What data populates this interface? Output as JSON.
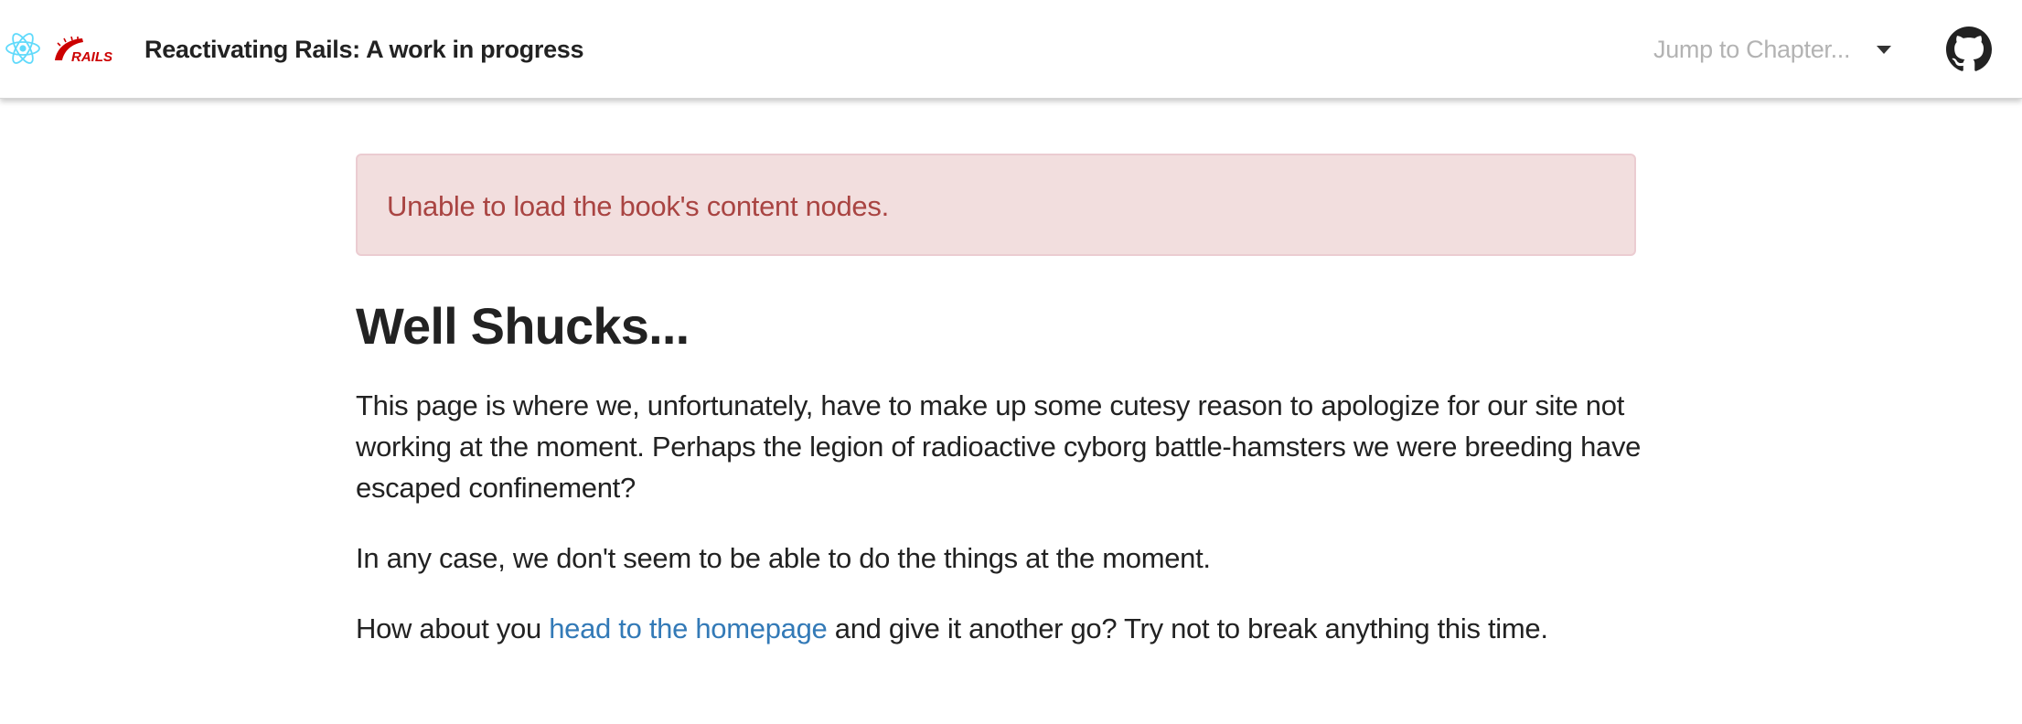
{
  "navbar": {
    "brand_title": "Reactivating Rails: A work in progress",
    "rails_logo_text": "RAILS",
    "chapter_select": {
      "placeholder": "Jump to Chapter..."
    },
    "icons": {
      "react_logo": "react-logo-icon",
      "rails_logo": "rails-logo-icon",
      "github": "github-icon",
      "dropdown": "caret-down-icon"
    }
  },
  "alert": {
    "message": "Unable to load the book's content nodes.",
    "background_color": "#f2dede",
    "border_color": "#ebccd1",
    "text_color": "#a94442"
  },
  "main": {
    "title": "Well Shucks...",
    "paragraph_1": "This page is where we, unfortunately, have to make up some cutesy reason to apologize for our site not working at the moment. Perhaps the legion of radioactive cyborg battle-hamsters we were breeding have escaped confinement?",
    "paragraph_2": "In any case, we don't seem to be able to do the things at the moment.",
    "paragraph_3_before": "How about you ",
    "paragraph_3_link": "head to the homepage",
    "paragraph_3_after": " and give it another go? Try not to break anything this time."
  },
  "colors": {
    "link": "#337ab7",
    "react_logo": "#61dafb",
    "rails_logo": "#cc0000"
  }
}
